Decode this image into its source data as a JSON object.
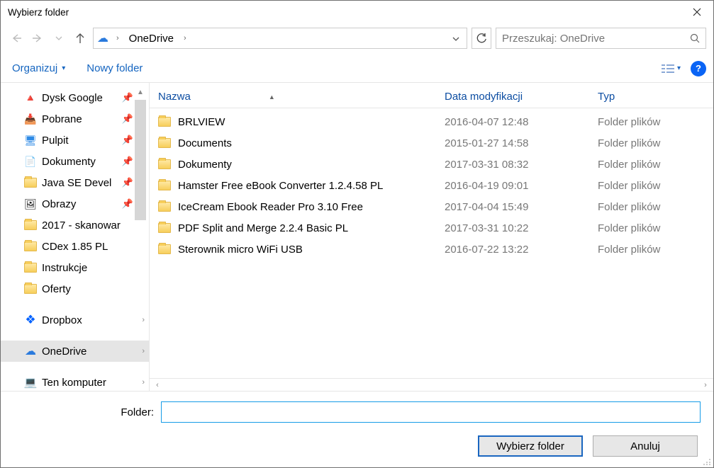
{
  "title": "Wybierz folder",
  "nav": {
    "breadcrumb": "OneDrive",
    "search_placeholder": "Przeszukaj: OneDrive"
  },
  "toolbar": {
    "organize": "Organizuj",
    "new_folder": "Nowy folder"
  },
  "tree": [
    {
      "label": "Dysk Google",
      "icon": "drive",
      "pin": true
    },
    {
      "label": "Pobrane",
      "icon": "folder-dl",
      "pin": true
    },
    {
      "label": "Pulpit",
      "icon": "desktop",
      "pin": true
    },
    {
      "label": "Dokumenty",
      "icon": "docs",
      "pin": true
    },
    {
      "label": "Java SE Devel",
      "icon": "folder",
      "pin": true
    },
    {
      "label": "Obrazy",
      "icon": "pictures",
      "pin": true
    },
    {
      "label": "2017 - skanowar",
      "icon": "folder"
    },
    {
      "label": "CDex 1.85 PL",
      "icon": "folder"
    },
    {
      "label": "Instrukcje",
      "icon": "folder"
    },
    {
      "label": "Oferty",
      "icon": "folder"
    },
    {
      "spacer": true
    },
    {
      "label": "Dropbox",
      "icon": "dropbox",
      "expand": true
    },
    {
      "spacer": true
    },
    {
      "label": "OneDrive",
      "icon": "onedrive",
      "expand": true,
      "selected": true
    },
    {
      "spacer": true
    },
    {
      "label": "Ten komputer",
      "icon": "pc",
      "expand": true
    }
  ],
  "columns": {
    "name": "Nazwa",
    "date": "Data modyfikacji",
    "type": "Typ"
  },
  "rows": [
    {
      "name": "BRLVIEW",
      "date": "2016-04-07 12:48",
      "type": "Folder plików"
    },
    {
      "name": "Documents",
      "date": "2015-01-27 14:58",
      "type": "Folder plików"
    },
    {
      "name": "Dokumenty",
      "date": "2017-03-31 08:32",
      "type": "Folder plików"
    },
    {
      "name": "Hamster Free eBook Converter 1.2.4.58 PL",
      "date": "2016-04-19 09:01",
      "type": "Folder plików"
    },
    {
      "name": "IceCream Ebook Reader Pro 3.10 Free",
      "date": "2017-04-04 15:49",
      "type": "Folder plików"
    },
    {
      "name": "PDF Split and Merge 2.2.4 Basic PL",
      "date": "2017-03-31 10:22",
      "type": "Folder plików"
    },
    {
      "name": "Sterownik micro WiFi USB",
      "date": "2016-07-22 13:22",
      "type": "Folder plików"
    }
  ],
  "footer": {
    "label": "Folder:",
    "value": "",
    "choose": "Wybierz folder",
    "cancel": "Anuluj"
  }
}
